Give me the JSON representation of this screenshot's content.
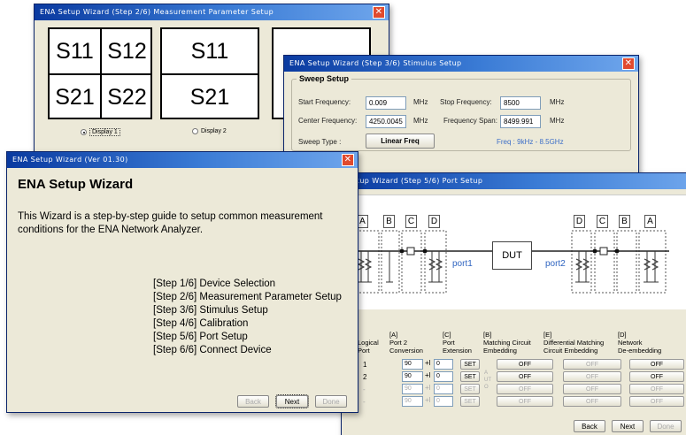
{
  "step2": {
    "title": "ENA Setup Wizard (Step 2/6) Measurement Parameter Setup",
    "display1": {
      "cells": [
        "S11",
        "S12",
        "S21",
        "S22"
      ],
      "radio_label": "Display 1",
      "selected": true
    },
    "display2": {
      "cells": [
        "S11",
        "S21"
      ],
      "radio_label": "Display 2",
      "selected": false
    }
  },
  "step3": {
    "title": "ENA Setup Wizard (Step 3/6) Stimulus Setup",
    "group_title": "Sweep Setup",
    "start_freq_label": "Start Frequency:",
    "start_freq_value": "0.009",
    "stop_freq_label": "Stop Frequency:",
    "stop_freq_value": "8500",
    "center_freq_label": "Center Frequency:",
    "center_freq_value": "4250.0045",
    "span_label": "Frequency Span:",
    "span_value": "8499.991",
    "unit": "MHz",
    "sweep_type_label": "Sweep Type :",
    "sweep_type_button": "Linear Freq",
    "freq_range": "Freq : 9kHz - 8.5GHz"
  },
  "intro": {
    "title": "ENA Setup Wizard (Ver 01.30)",
    "heading": "ENA Setup Wizard",
    "description": "This Wizard is a step-by-step guide to setup common measurement conditions for the ENA Network Analyzer.",
    "steps": [
      "[Step 1/6] Device Selection",
      "[Step 2/6] Measurement Parameter Setup",
      "[Step 3/6] Stimulus Setup",
      "[Step 4/6] Calibration",
      "[Step 5/6] Port Setup",
      "[Step 6/6] Connect Device"
    ],
    "back": "Back",
    "next": "Next",
    "done": "Done"
  },
  "step5": {
    "title": "Setup Wizard (Step 5/6) Port Setup",
    "diagram": {
      "left_labels": [
        "A",
        "B",
        "C",
        "D"
      ],
      "right_labels": [
        "D",
        "C",
        "B",
        "A"
      ],
      "dut": "DUT",
      "port1": "port1",
      "port2": "port2"
    },
    "headers": {
      "port": "rt",
      "logical": "Logical\nPort",
      "a": "[A]\nPort 2\nConversion",
      "c": "[C]\nPort\nExtension",
      "b": "[B]\nMatching Circuit\nEmbedding",
      "e": "[E]\nDifferential Matching\nCircuit Embedding",
      "d": "[D]\nNetwork\nDe-embedding"
    },
    "rows": [
      {
        "logical": "1",
        "deg": "90",
        "val": "0"
      },
      {
        "logical": "2",
        "deg": "90",
        "val": "0"
      },
      {
        "logical": "-",
        "deg": "90",
        "val": "0"
      },
      {
        "logical": "-",
        "deg": "90",
        "val": "0"
      }
    ],
    "set": "SET",
    "auto": "AUTO",
    "off": "OFF",
    "back": "Back",
    "next": "Next",
    "done": "Done"
  }
}
